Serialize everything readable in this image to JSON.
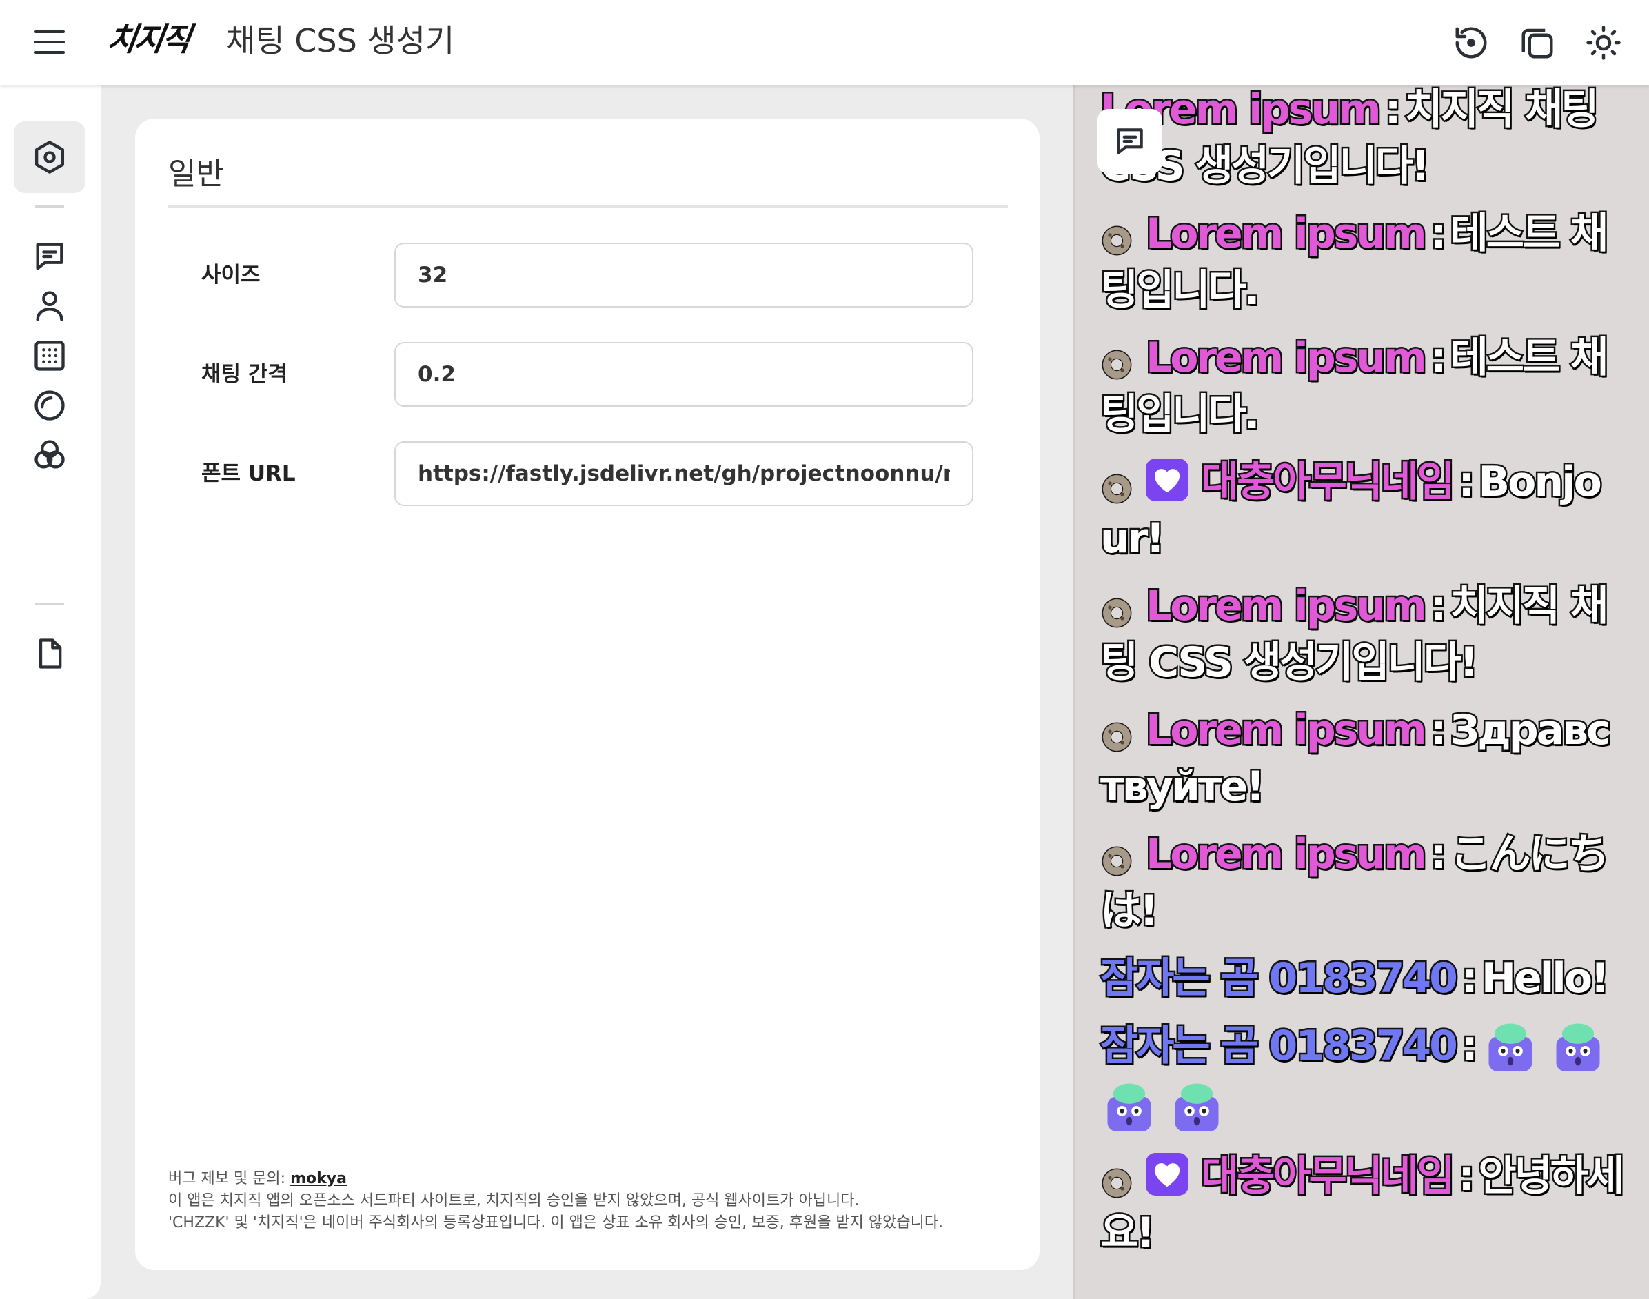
{
  "header": {
    "logo_text": "치지직",
    "title": "채팅 CSS 생성기",
    "icons": [
      "menu-icon",
      "reset-icon",
      "copy-icon",
      "theme-sun-icon"
    ]
  },
  "sidebar": {
    "items": [
      {
        "name": "settings-general",
        "icon": "hexagon-gear-icon",
        "active": true
      },
      {
        "name": "chat",
        "icon": "chat-bubble-icon"
      },
      {
        "name": "user",
        "icon": "user-icon"
      },
      {
        "name": "grid",
        "icon": "grid-dots-icon"
      },
      {
        "name": "shape",
        "icon": "circle-icon"
      },
      {
        "name": "colors",
        "icon": "color-circles-icon"
      },
      {
        "name": "file",
        "icon": "file-icon"
      }
    ]
  },
  "panel": {
    "title": "일반",
    "fields": [
      {
        "label": "사이즈",
        "value": "32"
      },
      {
        "label": "채팅 간격",
        "value": "0.2"
      },
      {
        "label": "폰트 URL",
        "value": "https://fastly.jsdelivr.net/gh/projectnoonnu/noonfo"
      }
    ],
    "footer": {
      "line1_prefix": "버그 제보 및 문의: ",
      "line1_link": "mokya",
      "line2": "이 앱은 치지직 앱의 오픈소스 서드파티 사이트로, 치지직의 승인을 받지 않았으며, 공식 웹사이트가 아닙니다.",
      "line3": "'CHZZK' 및 '치지직'은 네이버 주식회사의 등록상표입니다. 이 앱은 상표 소유 회사의 승인, 보증, 후원을 받지 않았습니다."
    }
  },
  "preview": {
    "toggle_icon": "chat-bubble-icon",
    "messages": [
      {
        "badges": [],
        "nick": "Lorem ipsum",
        "nick_color": "pink",
        "text": "치지직 채팅 CSS 생성기입니다!",
        "emotes": 0
      },
      {
        "badges": [
          "cookie"
        ],
        "nick": "Lorem ipsum",
        "nick_color": "pink",
        "text": "테스트 채팅입니다.",
        "emotes": 0
      },
      {
        "badges": [
          "cookie"
        ],
        "nick": "Lorem ipsum",
        "nick_color": "pink",
        "text": "테스트 채팅입니다.",
        "emotes": 0
      },
      {
        "badges": [
          "cookie",
          "heart"
        ],
        "nick": "대충아무닉네임",
        "nick_color": "pink",
        "text": "Bonjour!",
        "emotes": 0
      },
      {
        "badges": [
          "cookie"
        ],
        "nick": "Lorem ipsum",
        "nick_color": "pink",
        "text": "치지직 채팅 CSS 생성기입니다!",
        "emotes": 0
      },
      {
        "badges": [
          "cookie"
        ],
        "nick": "Lorem ipsum",
        "nick_color": "pink",
        "text": "Здравствуйте!",
        "emotes": 0
      },
      {
        "badges": [
          "cookie"
        ],
        "nick": "Lorem ipsum",
        "nick_color": "pink",
        "text": "こんにちは!",
        "emotes": 0
      },
      {
        "badges": [],
        "nick": "잠자는 곰 0183740",
        "nick_color": "blue",
        "text": "Hello!",
        "emotes": 0
      },
      {
        "badges": [],
        "nick": "잠자는 곰 0183740",
        "nick_color": "blue",
        "text": "",
        "emotes": 4
      },
      {
        "badges": [
          "cookie",
          "heart"
        ],
        "nick": "대충아무닉네임",
        "nick_color": "pink",
        "text": "안녕하세요!",
        "emotes": 0
      }
    ],
    "separator": ":"
  },
  "colors": {
    "nick_pink": "#e05ad7",
    "nick_blue": "#6f78f2",
    "badge_heart": "#7a45f0",
    "preview_bg": "#ddd9d8"
  }
}
